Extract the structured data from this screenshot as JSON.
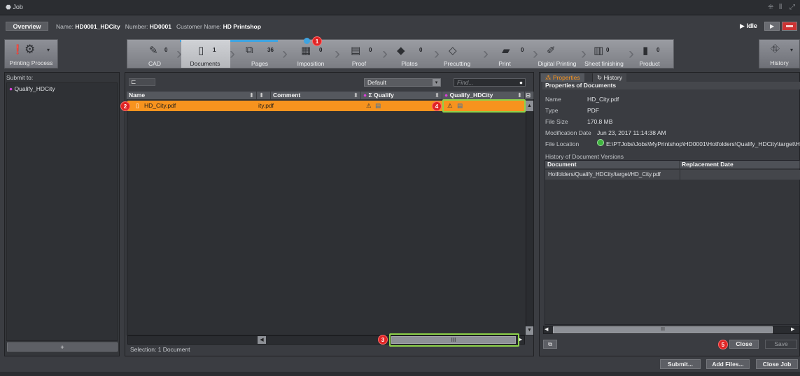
{
  "window": {
    "title": "Job",
    "controls": [
      "⁜",
      "⫴",
      "⤢"
    ]
  },
  "infobar": {
    "overview_label": "Overview",
    "name_label": "Name:",
    "name_value": "HD0001_HDCity",
    "number_label": "Number:",
    "number_value": "HD0001",
    "customer_label": "Customer Name:",
    "customer_value": "HD Printshop",
    "status": "Idle"
  },
  "left_side_button": {
    "label": "Printing Process"
  },
  "right_side_button": {
    "label": "History"
  },
  "workflow": [
    {
      "label": "CAD",
      "count": "0"
    },
    {
      "label": "Documents",
      "count": "1"
    },
    {
      "label": "Pages",
      "count": "36"
    },
    {
      "label": "Imposition",
      "count": "0"
    },
    {
      "label": "Proof",
      "count": "0"
    },
    {
      "label": "Plates",
      "count": "0"
    },
    {
      "label": "Precutting",
      "count": ""
    },
    {
      "label": "Print",
      "count": "0"
    },
    {
      "label": "Digital Printing",
      "count": ""
    },
    {
      "label": "Sheet finishing",
      "count": "0"
    },
    {
      "label": "Product",
      "count": "0"
    }
  ],
  "badges": [
    "1",
    "2",
    "3",
    "4",
    "5"
  ],
  "left_panel": {
    "header": "Submit to:",
    "items": [
      "Qualify_HDCity"
    ],
    "add_label": "+"
  },
  "documents": {
    "filter_value": "Default",
    "find_placeholder": "Find...",
    "columns": [
      "Name",
      "Comment",
      "Σ Qualify",
      "Qualify_HDCity"
    ],
    "rows": [
      {
        "name": "HD_City.pdf",
        "extra": "ity.pdf"
      }
    ],
    "selection": "Selection:  1 Document",
    "scroll_thumb": "III"
  },
  "right_panel": {
    "tabs": [
      "Properties",
      "History"
    ],
    "section_title": "Properties of Documents",
    "properties": [
      {
        "label": "Name",
        "value": "HD_City.pdf"
      },
      {
        "label": "Type",
        "value": "PDF"
      },
      {
        "label": "File Size",
        "value": "170.8 MB"
      },
      {
        "label": "Modification Date",
        "value": "Jun 23, 2017 11:14:38 AM"
      },
      {
        "label": "File Location",
        "value": "E:\\PTJobs\\Jobs\\MyPrintshop\\HD0001\\Hotfolders\\Qualify_HDCity\\target\\HD_C"
      }
    ],
    "history_title": "History of Document Versions",
    "history_columns": [
      "Document",
      "Replacement Date"
    ],
    "history_rows": [
      {
        "document": "Hotfolders/Qualify_HDCity/target/HD_City.pdf",
        "date": ""
      }
    ],
    "close_label": "Close",
    "save_label": "Save"
  },
  "bottom_buttons": {
    "submit": "Submit...",
    "add_files": "Add Files...",
    "close_job": "Close Job"
  },
  "colors": {
    "accent_orange": "#f7931e",
    "highlight_green": "#8ed24a",
    "badge_red": "#e02424"
  }
}
